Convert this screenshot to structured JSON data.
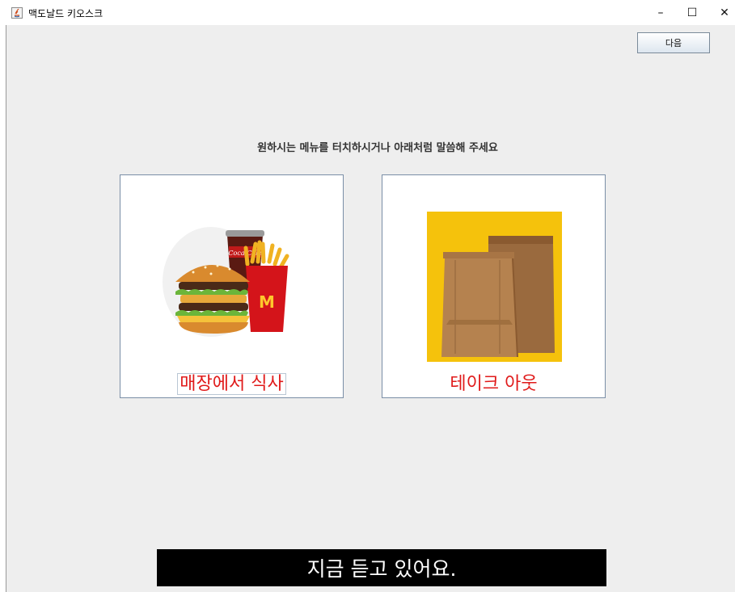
{
  "window": {
    "title": "맥도날드 키오스크",
    "controls": {
      "minimize": "–",
      "maximize": "☐",
      "close": "✕"
    }
  },
  "toolbar": {
    "next_label": "다음"
  },
  "instruction": "원하시는 메뉴를 터치하시거나 아래처럼 말씀해 주세요",
  "options": [
    {
      "label": "매장에서 식사",
      "icon": "burger-meal-icon"
    },
    {
      "label": "테이크 아웃",
      "icon": "paper-bag-icon"
    }
  ],
  "status": {
    "listening_text": "지금 듣고 있어요."
  },
  "colors": {
    "background": "#eeeeee",
    "option_label": "#e01a1a",
    "takeout_bg": "#f5c20c",
    "status_bar": "#000000"
  }
}
